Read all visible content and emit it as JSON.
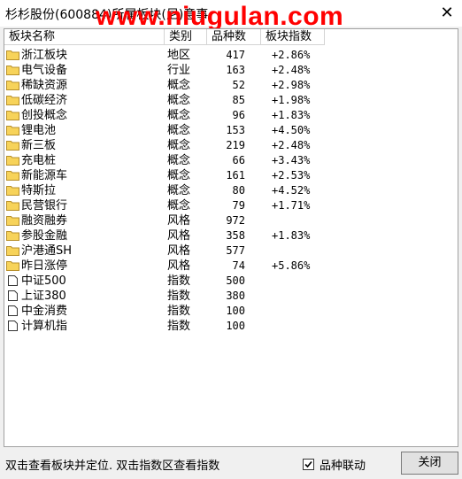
{
  "window": {
    "title": "杉杉股份(600884)所属板块(尼)意事",
    "watermark": "www.niugulan.com",
    "close_glyph": "✕"
  },
  "table": {
    "columns": [
      "板块名称",
      "类别",
      "品种数",
      "板块指数"
    ],
    "rows": [
      {
        "name": "浙江板块",
        "type": "地区",
        "count": "417",
        "index": "+2.86%",
        "icon": "folder-icon"
      },
      {
        "name": "电气设备",
        "type": "行业",
        "count": "163",
        "index": "+2.48%",
        "icon": "folder-icon"
      },
      {
        "name": "稀缺资源",
        "type": "概念",
        "count": "52",
        "index": "+2.98%",
        "icon": "folder-icon"
      },
      {
        "name": "低碳经济",
        "type": "概念",
        "count": "85",
        "index": "+1.98%",
        "icon": "folder-icon"
      },
      {
        "name": "创投概念",
        "type": "概念",
        "count": "96",
        "index": "+1.83%",
        "icon": "folder-icon"
      },
      {
        "name": "锂电池",
        "type": "概念",
        "count": "153",
        "index": "+4.50%",
        "icon": "folder-icon"
      },
      {
        "name": "新三板",
        "type": "概念",
        "count": "219",
        "index": "+2.48%",
        "icon": "folder-icon"
      },
      {
        "name": "充电桩",
        "type": "概念",
        "count": "66",
        "index": "+3.43%",
        "icon": "folder-icon"
      },
      {
        "name": "新能源车",
        "type": "概念",
        "count": "161",
        "index": "+2.53%",
        "icon": "folder-icon"
      },
      {
        "name": "特斯拉",
        "type": "概念",
        "count": "80",
        "index": "+4.52%",
        "icon": "folder-icon"
      },
      {
        "name": "民营银行",
        "type": "概念",
        "count": "79",
        "index": "+1.71%",
        "icon": "folder-icon"
      },
      {
        "name": "融资融券",
        "type": "风格",
        "count": "972",
        "index": "",
        "icon": "folder-icon"
      },
      {
        "name": "参股金融",
        "type": "风格",
        "count": "358",
        "index": "+1.83%",
        "icon": "folder-icon"
      },
      {
        "name": "沪港通SH",
        "type": "风格",
        "count": "577",
        "index": "",
        "icon": "folder-icon"
      },
      {
        "name": "昨日涨停",
        "type": "风格",
        "count": "74",
        "index": "+5.86%",
        "icon": "folder-icon"
      },
      {
        "name": "中证500",
        "type": "指数",
        "count": "500",
        "index": "",
        "icon": "document-icon"
      },
      {
        "name": "上证380",
        "type": "指数",
        "count": "380",
        "index": "",
        "icon": "document-icon"
      },
      {
        "name": "中金消费",
        "type": "指数",
        "count": "100",
        "index": "",
        "icon": "document-icon"
      },
      {
        "name": "计算机指",
        "type": "指数",
        "count": "100",
        "index": "",
        "icon": "document-icon"
      }
    ]
  },
  "footer": {
    "hint": "双击查看板块并定位. 双击指数区查看指数",
    "checkbox_label": "品种联动",
    "checkbox_checked": true,
    "close_button": "关闭"
  },
  "colors": {
    "watermark": "#ff0000",
    "folder_fill": "#f7d35a",
    "folder_stroke": "#b8902a"
  }
}
